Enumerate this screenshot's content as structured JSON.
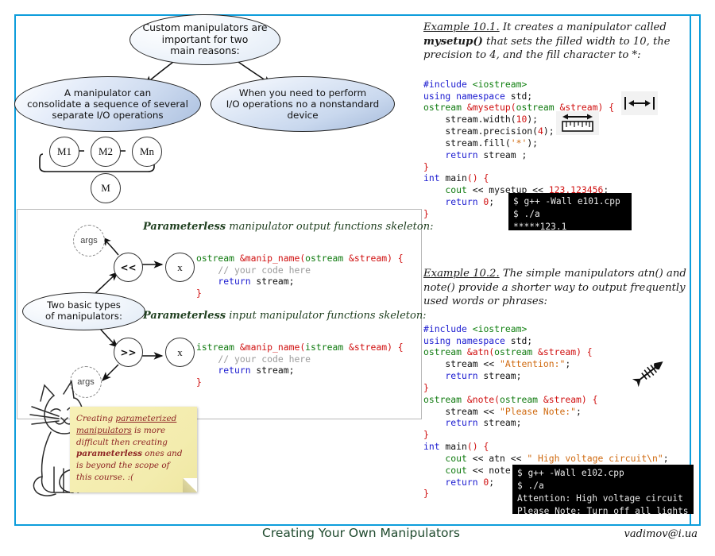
{
  "frame": {
    "accent_color": "#0d9ddb"
  },
  "concept_map": {
    "root": {
      "text": "Custom manipulators are\nimportant for two\nmain reasons:"
    },
    "branches": [
      {
        "text": "A manipulator can\nconsolidate a sequence of several\nseparate I/O operations"
      },
      {
        "text": "When you need to perform\nI/O operations no a nonstandard\ndevice"
      }
    ],
    "chain": {
      "nodes": [
        "M1",
        "M2",
        "Mn"
      ],
      "result": "M"
    }
  },
  "types_panel": {
    "center_label": "Two basic types\nof manipulators:",
    "args_label_top": "args",
    "args_label_bottom": "args",
    "op_out": "<<",
    "op_in": ">>",
    "x_out": "x",
    "x_in": "x",
    "output_title_bold": "Parameterless",
    "output_title_rest": " manipulator output functions skeleton:",
    "input_title_bold": "Parameterless",
    "input_title_rest": " input manipulator functions skeleton:",
    "output_code": {
      "l1_t1": "ostream",
      "l1_t2": " &manip_name",
      "l1_t3": "(",
      "l1_t4": "ostream",
      "l1_t5": " &stream",
      "l1_t6": ") {",
      "l2": "    // your code here",
      "l3_a": "    return",
      "l3_b": " stream;",
      "l4": "}"
    },
    "input_code": {
      "l1_t1": "istream",
      "l1_t2": " &manip_name",
      "l1_t3": "(",
      "l1_t4": "istream",
      "l1_t5": " &stream",
      "l1_t6": ") {",
      "l2": "    // your code here",
      "l3_a": "    return",
      "l3_b": " stream;",
      "l4": "}"
    }
  },
  "sticky_note": {
    "p1": "Creating ",
    "u1": "parameterized manipulators",
    "p2": " is more difficult then creating ",
    "b1": "parameterless",
    "p3": " ones and is beyond the scope of this course.  :("
  },
  "example1": {
    "label": "Example 10.1.",
    "text": " It creates a manipulator called ",
    "bold": "mysetup()",
    "text2": " that sets the filled width to 10, the precision to 4, and the fill character to *:",
    "code": {
      "l1_a": "#include",
      "l1_b": " <iostream>",
      "l2_a": "using namespace",
      "l2_b": " std;",
      "l3_a": "ostream",
      "l3_b": " &mysetup",
      "l3_c": "(",
      "l3_d": "ostream",
      "l3_e": " &stream",
      "l3_f": ") {",
      "l4_a": "    stream.width(",
      "l4_b": "10",
      "l4_c": ");",
      "l5_a": "    stream.precision(",
      "l5_b": "4",
      "l5_c": ");",
      "l6_a": "    stream.fill(",
      "l6_b": "'*'",
      "l6_c": ");",
      "l7_a": "    return",
      "l7_b": " stream ;",
      "l8": "}",
      "l9_a": "int",
      "l9_b": " main",
      "l9_c": "() {",
      "l10_a": "    cout",
      "l10_b": " << mysetup << ",
      "l10_c": "123.123456",
      "l10_d": ";",
      "l11_a": "    return",
      "l11_b": " 0",
      "l11_c": ";",
      "l12": "}"
    },
    "terminal": "$ g++ -Wall e101.cpp\n$ ./a\n*****123.1",
    "icons": [
      "width-arrow-icon",
      "ruler-precision-icon"
    ]
  },
  "example2": {
    "label": "Example 10.2.",
    "text": " The simple manipulators atn() and note() provide a shorter way to output frequently used words or phrases:",
    "code": {
      "l1_a": "#include",
      "l1_b": " <iostream>",
      "l2_a": "using namespace",
      "l2_b": " std;",
      "l3_a": "ostream",
      "l3_b": " &atn",
      "l3_c": "(",
      "l3_d": "ostream",
      "l3_e": " &stream",
      "l3_f": ") {",
      "l4_a": "    stream << ",
      "l4_b": "\"Attention:\"",
      "l4_c": ";",
      "l5_a": "    return",
      "l5_b": " stream;",
      "l6": "}",
      "l7_a": "ostream",
      "l7_b": " &note",
      "l7_c": "(",
      "l7_d": "ostream",
      "l7_e": " &stream",
      "l7_f": ") {",
      "l8_a": "    stream << ",
      "l8_b": "\"Please Note:\"",
      "l8_c": ";",
      "l9_a": "    return",
      "l9_b": " stream;",
      "l10": "}",
      "l11_a": "int",
      "l11_b": " main",
      "l11_c": "() {",
      "l12_a": "    cout",
      "l12_b": " << atn << ",
      "l12_c": "\" High voltage circuit\\n\"",
      "l12_d": ";",
      "l13_a": "    cout",
      "l13_b": " << note << ",
      "l13_c": "\" Turn off all lights\\n\"",
      "l13_d": ";",
      "l14_a": "    return",
      "l14_b": " 0",
      "l14_c": ";",
      "l15": "}"
    },
    "terminal": "$ g++ -Wall e102.cpp\n$ ./a\nAttention: High voltage circuit\nPlease Note: Turn off all lights",
    "icon": "fish-skeleton-icon"
  },
  "footer": {
    "title": "Creating Your Own Manipulators",
    "email": "vadimov@i.ua"
  }
}
